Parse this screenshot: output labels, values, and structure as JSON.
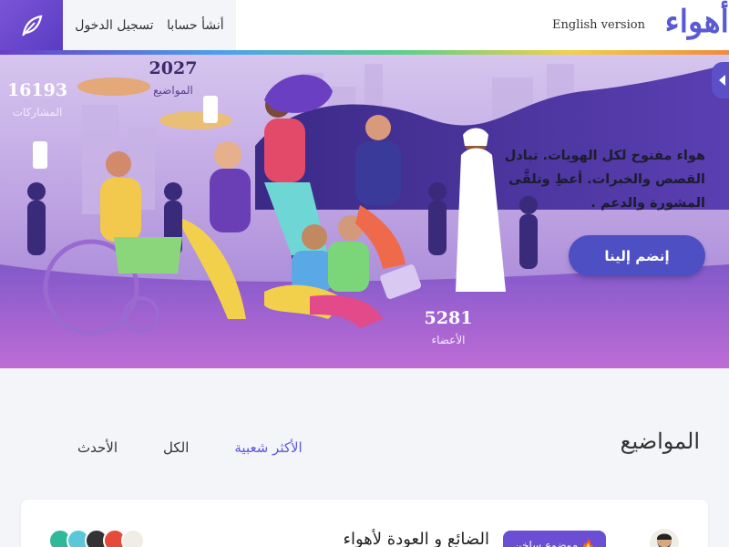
{
  "header": {
    "brand": "أهواء",
    "english_link": "English version",
    "signup_label": "أنشأ حسابا",
    "login_label": "تسجيل الدخول"
  },
  "hero": {
    "tagline": "هواء مفتوح لكل الهويات. تبادل القصص والخبرات. أعطِ وتلقَّى المشورة والدعم .",
    "join_label": "إنضم إلينا",
    "stats": {
      "posts": {
        "value": "16193",
        "label": "المشاركات"
      },
      "topics": {
        "value": "2027",
        "label": "المواضيع"
      },
      "members": {
        "value": "5281",
        "label": "الأعضاء"
      }
    }
  },
  "topics": {
    "title": "المواضيع",
    "tabs": [
      {
        "label": "الأكثر شعبية",
        "active": true
      },
      {
        "label": "الكل",
        "active": false
      },
      {
        "label": "الأحدث",
        "active": false
      }
    ]
  },
  "card": {
    "badge": "موضوع ساخن",
    "title": "الضائع و العودة لأهواء"
  },
  "colors": {
    "accent": "#5a5ad6",
    "join_button": "#4d4fc3",
    "badge": "#6a4fd4"
  }
}
